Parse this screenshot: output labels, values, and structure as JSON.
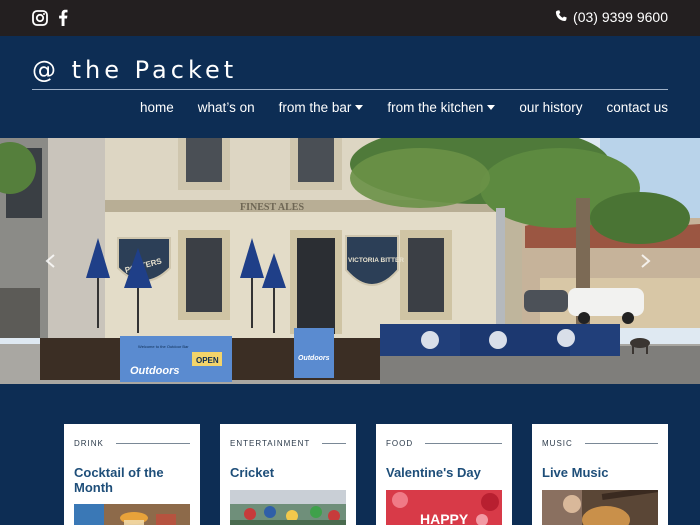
{
  "topbar": {
    "social": [
      {
        "icon": "instagram-icon"
      },
      {
        "icon": "facebook-icon"
      }
    ],
    "phone": "(03) 9399 9600"
  },
  "header": {
    "brand": "@ the Packet",
    "nav": [
      {
        "label": "home",
        "dropdown": false
      },
      {
        "label": "what’s on",
        "dropdown": false
      },
      {
        "label": "from the bar",
        "dropdown": true
      },
      {
        "label": "from the kitchen",
        "dropdown": true
      },
      {
        "label": "our history",
        "dropdown": false
      },
      {
        "label": "contact us",
        "dropdown": false
      }
    ]
  },
  "hero": {
    "signage": {
      "fascia": "FINEST ALES",
      "sign_left": "POTTERS",
      "sign_right": "VICTORIA BITTER",
      "banner_left": "Outdoors",
      "banner_left_small": "Welcome to the Outdoor Bar",
      "banner_open": "OPEN",
      "banner_mid": "Outdoors"
    }
  },
  "cards": [
    {
      "category": "DRINK",
      "title": "Cocktail of the Month"
    },
    {
      "category": "ENTERTAINMENT",
      "title": "Cricket"
    },
    {
      "category": "FOOD",
      "title": "Valentine's Day",
      "image_text": "HAPPY"
    },
    {
      "category": "MUSIC",
      "title": "Live Music"
    }
  ],
  "colors": {
    "topbar": "#231f20",
    "navy": "#0d2d54",
    "card_title": "#1e4e79"
  }
}
